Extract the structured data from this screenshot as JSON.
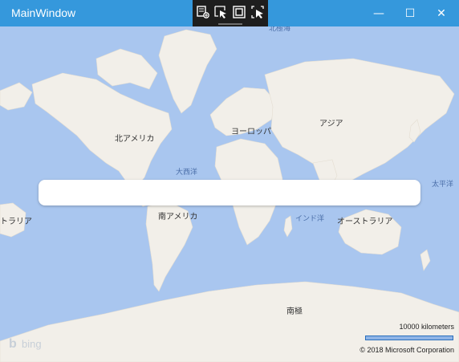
{
  "window": {
    "title": "MainWindow"
  },
  "titlebar_buttons": {
    "minimize": "—",
    "maximize": "☐",
    "close": "✕"
  },
  "devtools": [
    "select-element-icon",
    "pointer-select-icon",
    "display-layout-adorners-icon",
    "track-focused-element-icon"
  ],
  "map": {
    "labels": {
      "north_america": "北アメリカ",
      "europe": "ヨーロッパ",
      "asia": "アジア",
      "atlantic": "大西洋",
      "pacific": "太平洋",
      "south_america": "南アメリカ",
      "indian_ocean": "インド洋",
      "australia": "オーストラリア",
      "australia_left": "トラリア",
      "antarctica": "南極",
      "arctic_partial": "北極海"
    },
    "search_value": "",
    "search_placeholder": "",
    "scale_label": "10000 kilometers",
    "copyright": "© 2018 Microsoft Corporation",
    "brand": "bing",
    "colors": {
      "water": "#a9c6ef",
      "land": "#f2efe9",
      "titlebar": "#3598dc"
    }
  }
}
